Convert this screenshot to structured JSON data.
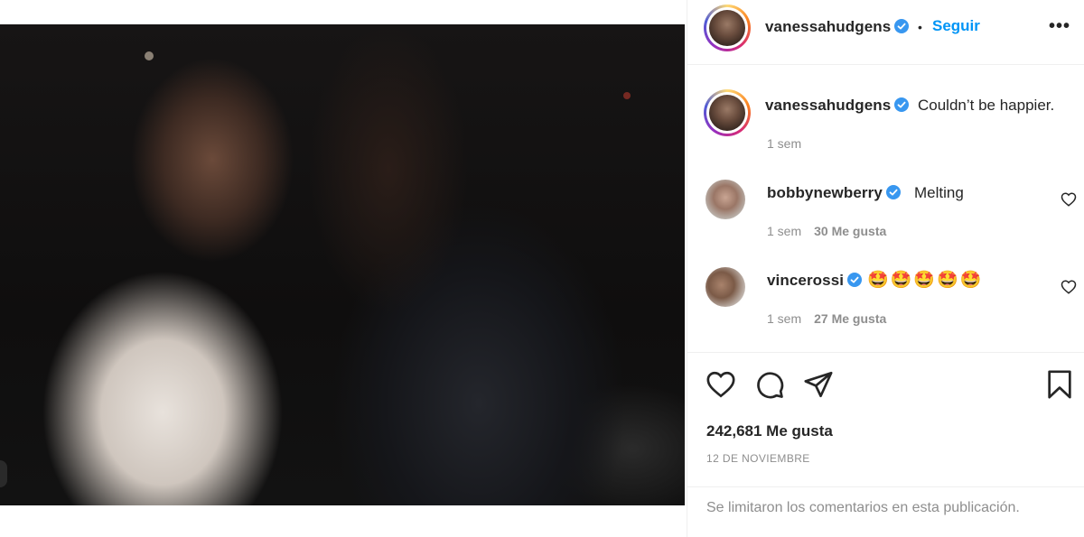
{
  "post": {
    "photo_description_icon": "photo",
    "author": {
      "username": "vanessahudgens",
      "verified": true,
      "follow_label": "Seguir",
      "separator": "•",
      "more_label": "•••"
    },
    "caption": {
      "username": "vanessahudgens",
      "text": "Couldn’t be happier.",
      "age": "1 sem"
    },
    "comments": [
      {
        "username": "bobbynewberry",
        "text": "Melting",
        "age": "1 sem",
        "likes": "30 Me gusta"
      },
      {
        "username": "vincerossi",
        "text": "🤩🤩🤩🤩🤩",
        "age": "1 sem",
        "likes": "27 Me gusta"
      }
    ],
    "likes_count": "242,681 Me gusta",
    "date": "12 DE NOVIEMBRE",
    "comments_limited": "Se limitaron los comentarios en esta publicación."
  },
  "colors": {
    "accent_blue": "#0095f6",
    "verified_blue": "#3897f0",
    "muted": "#8e8e8e",
    "text": "#262626"
  }
}
